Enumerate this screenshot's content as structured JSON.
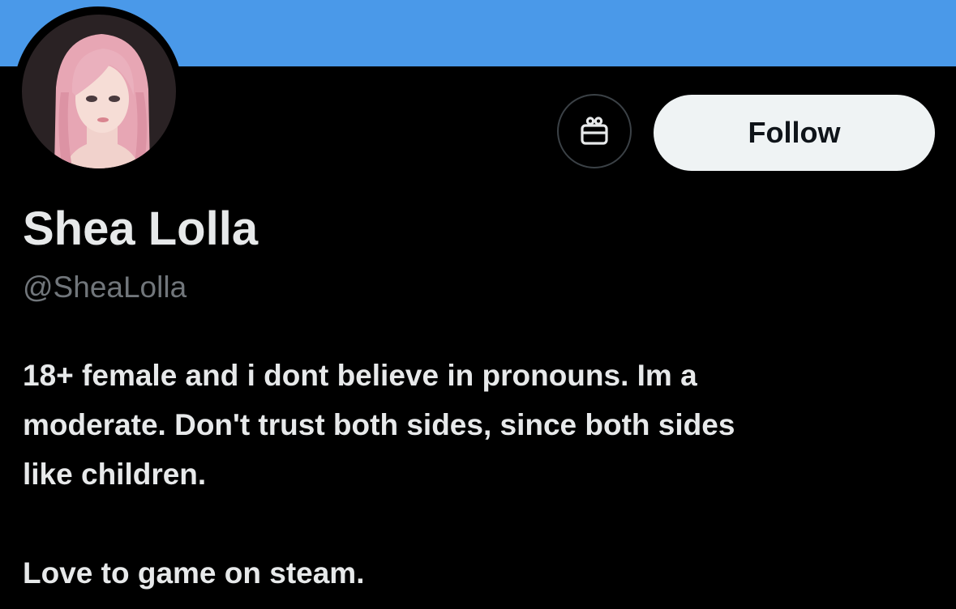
{
  "colors": {
    "banner": "#4a99e9",
    "background": "#000000",
    "primary_text": "#e7e9ea",
    "secondary_text": "#71767b",
    "follow_button_bg": "#eff3f4",
    "follow_button_text": "#0f1419",
    "gift_button_border": "#3b4146"
  },
  "profile": {
    "avatar_icon": "profile-avatar",
    "display_name": "Shea Lolla",
    "handle": "@SheaLolla",
    "bio_lines": [
      "18+ female and i dont believe in pronouns. Im a",
      "moderate. Don't trust both sides, since both sides",
      "like children.",
      "",
      "Love to game on steam."
    ]
  },
  "actions": {
    "gift_icon": "gift-icon",
    "follow_label": "Follow"
  }
}
